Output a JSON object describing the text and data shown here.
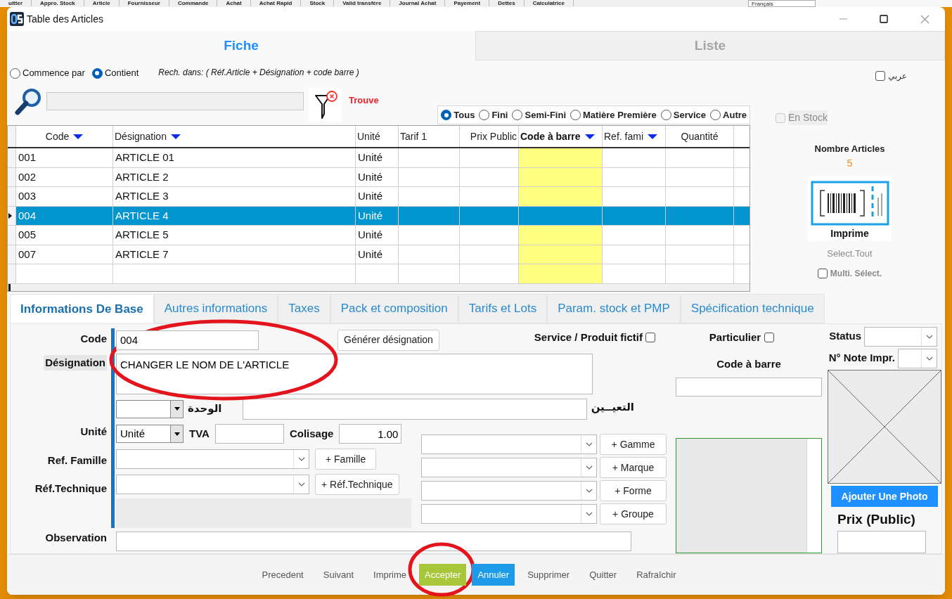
{
  "background_menu": [
    "uitter",
    "Appro. Stock",
    "Article",
    "Fournisseur",
    "Commande",
    "Achat",
    "Achat Rapid",
    "Stock",
    "Valid transfére",
    "Journal Achat",
    "Payement",
    "Dettes",
    "Calculatrice"
  ],
  "language": "Français",
  "window": {
    "title": "Table des Articles"
  },
  "view_tabs": [
    {
      "label": "Fiche",
      "selected": true
    },
    {
      "label": "Liste",
      "selected": false
    }
  ],
  "search": {
    "modes": [
      {
        "label": "Commence par",
        "selected": false
      },
      {
        "label": "Contient",
        "selected": true
      }
    ],
    "scope_note": "Rech. dans: ( Réf.Article + Désignation + code barre )",
    "status": "Trouve",
    "arabic": {
      "label": "عربي",
      "checked": false
    }
  },
  "type_filter": [
    {
      "label": "Tous",
      "selected": true
    },
    {
      "label": "Fini",
      "selected": false
    },
    {
      "label": "Semi-Fini",
      "selected": false
    },
    {
      "label": "Matière Première",
      "selected": false
    },
    {
      "label": "Service",
      "selected": false
    },
    {
      "label": "Autre",
      "selected": false
    }
  ],
  "in_stock": {
    "label": "En Stock",
    "checked": false,
    "disabled": true
  },
  "table": {
    "columns": [
      {
        "label": "Code",
        "sort_arrow": true,
        "highlight": false
      },
      {
        "label": "Désignation",
        "sort_arrow": true,
        "highlight": false
      },
      {
        "label": "Unité",
        "sort_arrow": false,
        "highlight": false
      },
      {
        "label": "Tarif 1",
        "sort_arrow": false,
        "highlight": false
      },
      {
        "label": "Prix Public",
        "sort_arrow": false,
        "highlight": false
      },
      {
        "label": "Code à barre",
        "sort_arrow": true,
        "highlight": true
      },
      {
        "label": "Ref. fami",
        "sort_arrow": true,
        "highlight": false
      },
      {
        "label": "Quantité",
        "sort_arrow": false,
        "highlight": false
      }
    ],
    "rows": [
      {
        "code": "001",
        "designation": "ARTICLE 01",
        "unit": "Unité",
        "selected": false
      },
      {
        "code": "002",
        "designation": "ARTICLE 2",
        "unit": "Unité",
        "selected": false
      },
      {
        "code": "003",
        "designation": "ARTICLE 3",
        "unit": "Unité",
        "selected": false
      },
      {
        "code": "004",
        "designation": "ARTICLE 4",
        "unit": "Unité",
        "selected": true
      },
      {
        "code": "005",
        "designation": "ARTICLE 5",
        "unit": "Unité",
        "selected": false
      },
      {
        "code": "007",
        "designation": "ARTICLE 7",
        "unit": "Unité",
        "selected": false
      }
    ]
  },
  "summary": {
    "count_label": "Nombre Articles",
    "count": "5",
    "print_label": "Imprime",
    "select_all": "Select.Tout",
    "multi_select": {
      "label": "Multi. Sélect.",
      "checked": false
    }
  },
  "detail_tabs": [
    {
      "label": "Informations De Base",
      "selected": true
    },
    {
      "label": "Autres informations",
      "selected": false
    },
    {
      "label": "Taxes",
      "selected": false
    },
    {
      "label": "Pack et composition",
      "selected": false
    },
    {
      "label": "Tarifs et Lots",
      "selected": false
    },
    {
      "label": "Param. stock et PMP",
      "selected": false
    },
    {
      "label": "Spécification technique",
      "selected": false
    }
  ],
  "form": {
    "code_label": "Code",
    "code": "004",
    "generate_button": "Générer désignation",
    "service": {
      "label": "Service / Produit fictif",
      "checked": false
    },
    "designation_label": "Désignation",
    "designation": "CHANGER LE NOM DE L'ARTICLE",
    "unit_ar_label": "الوحدة",
    "designation_ar_label": "التعيــين",
    "unit_label": "Unité",
    "unit": "Unité",
    "tva_label": "TVA",
    "colisage_label": "Colisage",
    "colisage": "1.00",
    "family_label": "Ref. Famille",
    "family_button": "+ Famille",
    "technical_label": "Réf.Technique",
    "technical_button": "+ Réf.Technique",
    "extra_buttons": [
      "+ Gamme",
      "+ Marque",
      "+ Forme",
      "+ Groupe"
    ],
    "observation_label": "Observation",
    "particulier": {
      "label": "Particulier",
      "checked": false
    },
    "barcode_label": "Code à barre",
    "status_label": "Status",
    "note_label": "N° Note Impr.",
    "photo_button": "Ajouter Une Photo",
    "price_label": "Prix (Public)"
  },
  "actions": [
    {
      "label": "Precedent",
      "kind": "link"
    },
    {
      "label": "Suivant",
      "kind": "link"
    },
    {
      "label": "Imprime",
      "kind": "link"
    },
    {
      "label": "Accepter",
      "kind": "accept"
    },
    {
      "label": "Annuler",
      "kind": "cancel"
    },
    {
      "label": "Supprimer",
      "kind": "link"
    },
    {
      "label": "Quitter",
      "kind": "link"
    },
    {
      "label": "Rafraîchir",
      "kind": "link"
    }
  ]
}
